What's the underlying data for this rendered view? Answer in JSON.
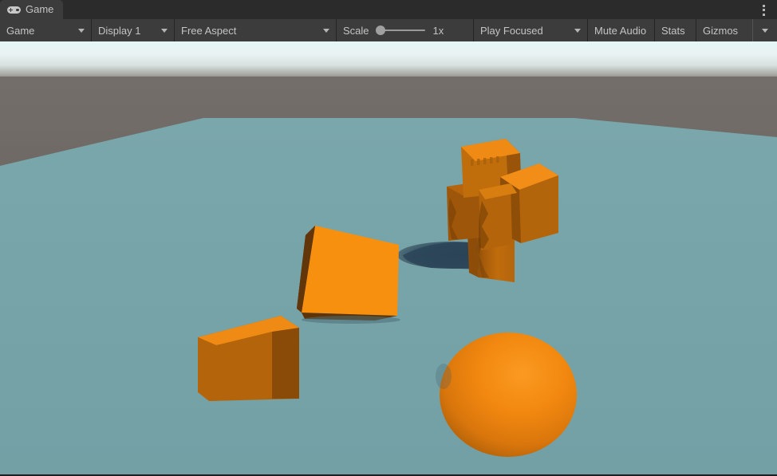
{
  "window": {
    "title": "Game",
    "tab_icon": "gamepad-icon",
    "menu_icon": "kebab-menu-icon"
  },
  "toolbar": {
    "view_selector": {
      "label": "Game",
      "icon": "chevron-down-icon"
    },
    "display_selector": {
      "label": "Display 1",
      "icon": "chevron-down-icon"
    },
    "aspect_selector": {
      "label": "Free Aspect",
      "icon": "chevron-down-icon"
    },
    "scale": {
      "label": "Scale",
      "value": "1x",
      "slider_position_percent": 0,
      "min": 1,
      "max": 5
    },
    "play_mode_selector": {
      "label": "Play Focused",
      "icon": "chevron-down-icon"
    },
    "mute_audio": {
      "label": "Mute Audio",
      "active": false
    },
    "stats": {
      "label": "Stats",
      "active": false
    },
    "gizmos": {
      "label": "Gizmos",
      "active": false,
      "icon": "chevron-down-icon"
    }
  },
  "scene": {
    "description": "Unity 3D game view with orange primitive objects on a teal ground plane",
    "colors": {
      "sky_top": "#d9f2f2",
      "sky_haze": "#e8f3f3",
      "background_wall": "#6f6a66",
      "ground": "#74a3a8",
      "orange_bright": "#f58b16",
      "orange_mid": "#d4780f",
      "orange_dark": "#a85c0a",
      "orange_darker": "#7d4408",
      "shadow": "#2e4558",
      "panel": "#3c3c3c",
      "panel_dark": "#2b2b2b",
      "text": "#c4c4c4"
    },
    "objects": [
      {
        "name": "cube-stack-tower",
        "type": "cube-cluster",
        "count": 4,
        "position": "upper-center-right"
      },
      {
        "name": "floating-rotated-cube",
        "type": "cube",
        "position": "center-left"
      },
      {
        "name": "ground-cube",
        "type": "cube",
        "position": "lower-left"
      },
      {
        "name": "sphere",
        "type": "sphere",
        "position": "lower-center-right"
      },
      {
        "name": "cast-shadow",
        "type": "shadow",
        "position": "behind-cube-stack"
      }
    ]
  }
}
